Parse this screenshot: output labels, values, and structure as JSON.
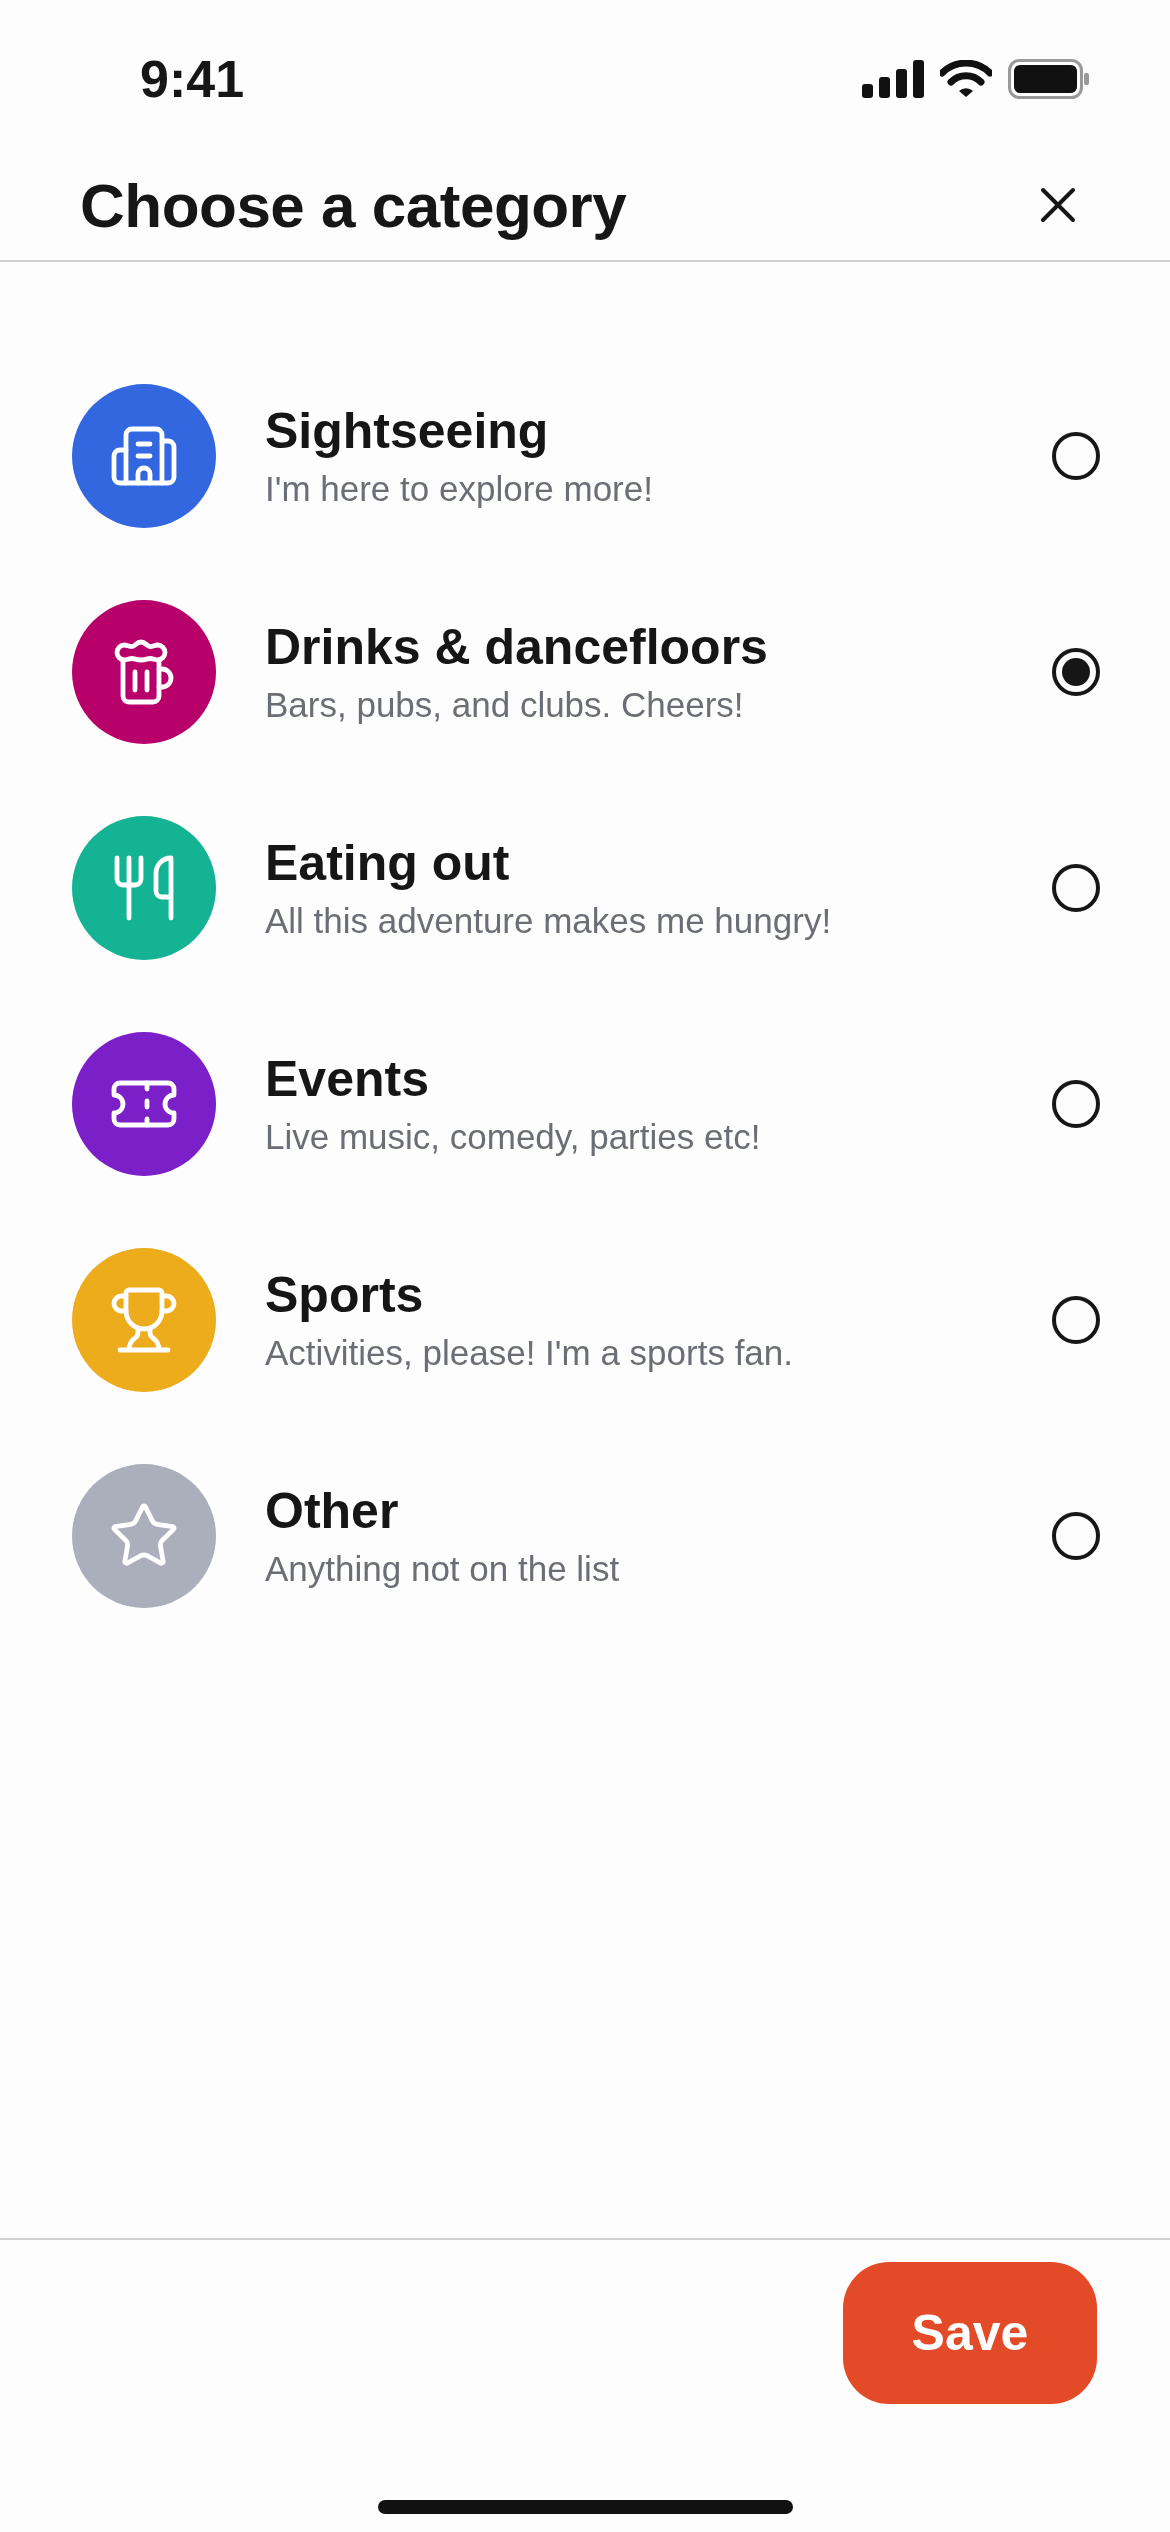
{
  "status_bar": {
    "time": "9:41"
  },
  "header": {
    "title": "Choose a category"
  },
  "categories": [
    {
      "title": "Sightseeing",
      "subtitle": "I'm here to explore more!",
      "color": "#3367e0",
      "selected": false
    },
    {
      "title": "Drinks & dancefloors",
      "subtitle": "Bars, pubs, and clubs. Cheers!",
      "color": "#b8006b",
      "selected": true
    },
    {
      "title": "Eating out",
      "subtitle": "All this adventure makes me hungry!",
      "color": "#14b393",
      "selected": false
    },
    {
      "title": "Events",
      "subtitle": "Live music, comedy, parties etc!",
      "color": "#7b1fc9",
      "selected": false
    },
    {
      "title": "Sports",
      "subtitle": "Activities, please! I'm a sports fan.",
      "color": "#ecac1c",
      "selected": false
    },
    {
      "title": "Other",
      "subtitle": "Anything not on the list",
      "color": "#abafbc",
      "selected": false
    }
  ],
  "footer": {
    "save_label": "Save"
  }
}
